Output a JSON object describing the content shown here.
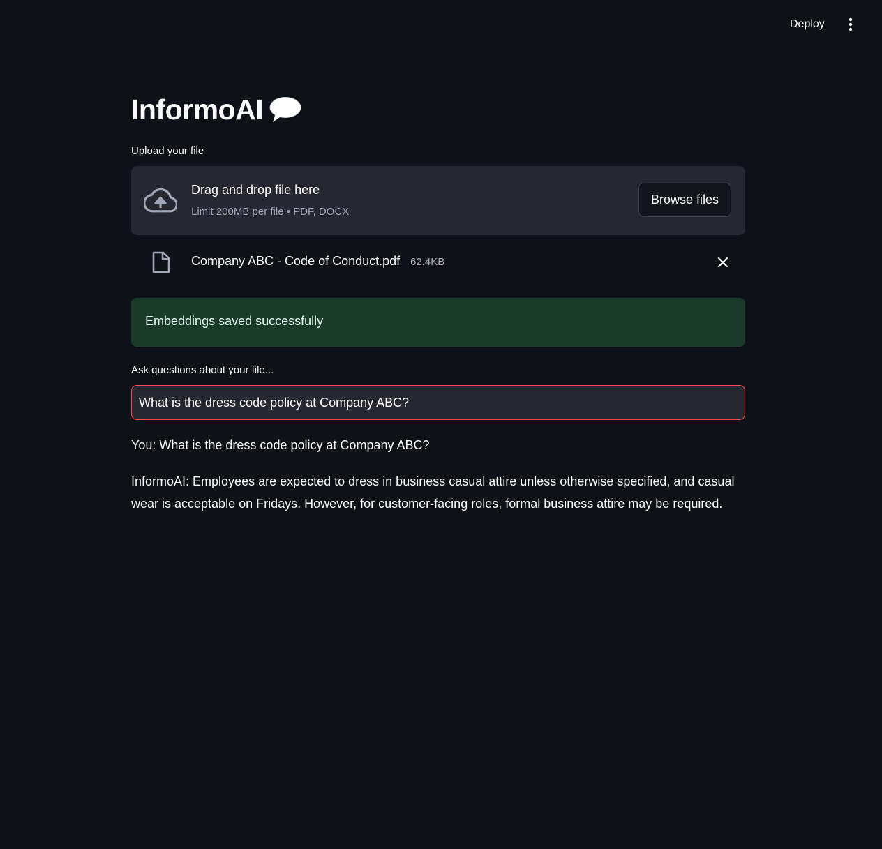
{
  "header": {
    "deploy_label": "Deploy",
    "menu_icon": "vertical-ellipsis-icon"
  },
  "app": {
    "title": "InformoAI",
    "title_icon": "speech-balloon-icon"
  },
  "uploader": {
    "label": "Upload your file",
    "drag_text": "Drag and drop file here",
    "limit_text": "Limit 200MB per file • PDF, DOCX",
    "browse_label": "Browse files",
    "icon": "cloud-upload-icon"
  },
  "uploaded_file": {
    "name": "Company ABC - Code of Conduct.pdf",
    "size": "62.4KB",
    "icon": "file-icon"
  },
  "status": {
    "message": "Embeddings saved successfully",
    "color": "#1b3a2a"
  },
  "query": {
    "label": "Ask questions about your file...",
    "value": "What is the dress code policy at Company ABC?"
  },
  "chat": [
    {
      "text": "You: What is the dress code policy at Company ABC?"
    },
    {
      "text": "InformoAI: Employees are expected to dress in business casual attire unless otherwise specified, and casual wear is acceptable on Fridays. However, for customer-facing roles, formal business attire may be required."
    }
  ],
  "colors": {
    "background": "#0e1117",
    "accent": "#ff4b4b",
    "surface": "#262730"
  }
}
